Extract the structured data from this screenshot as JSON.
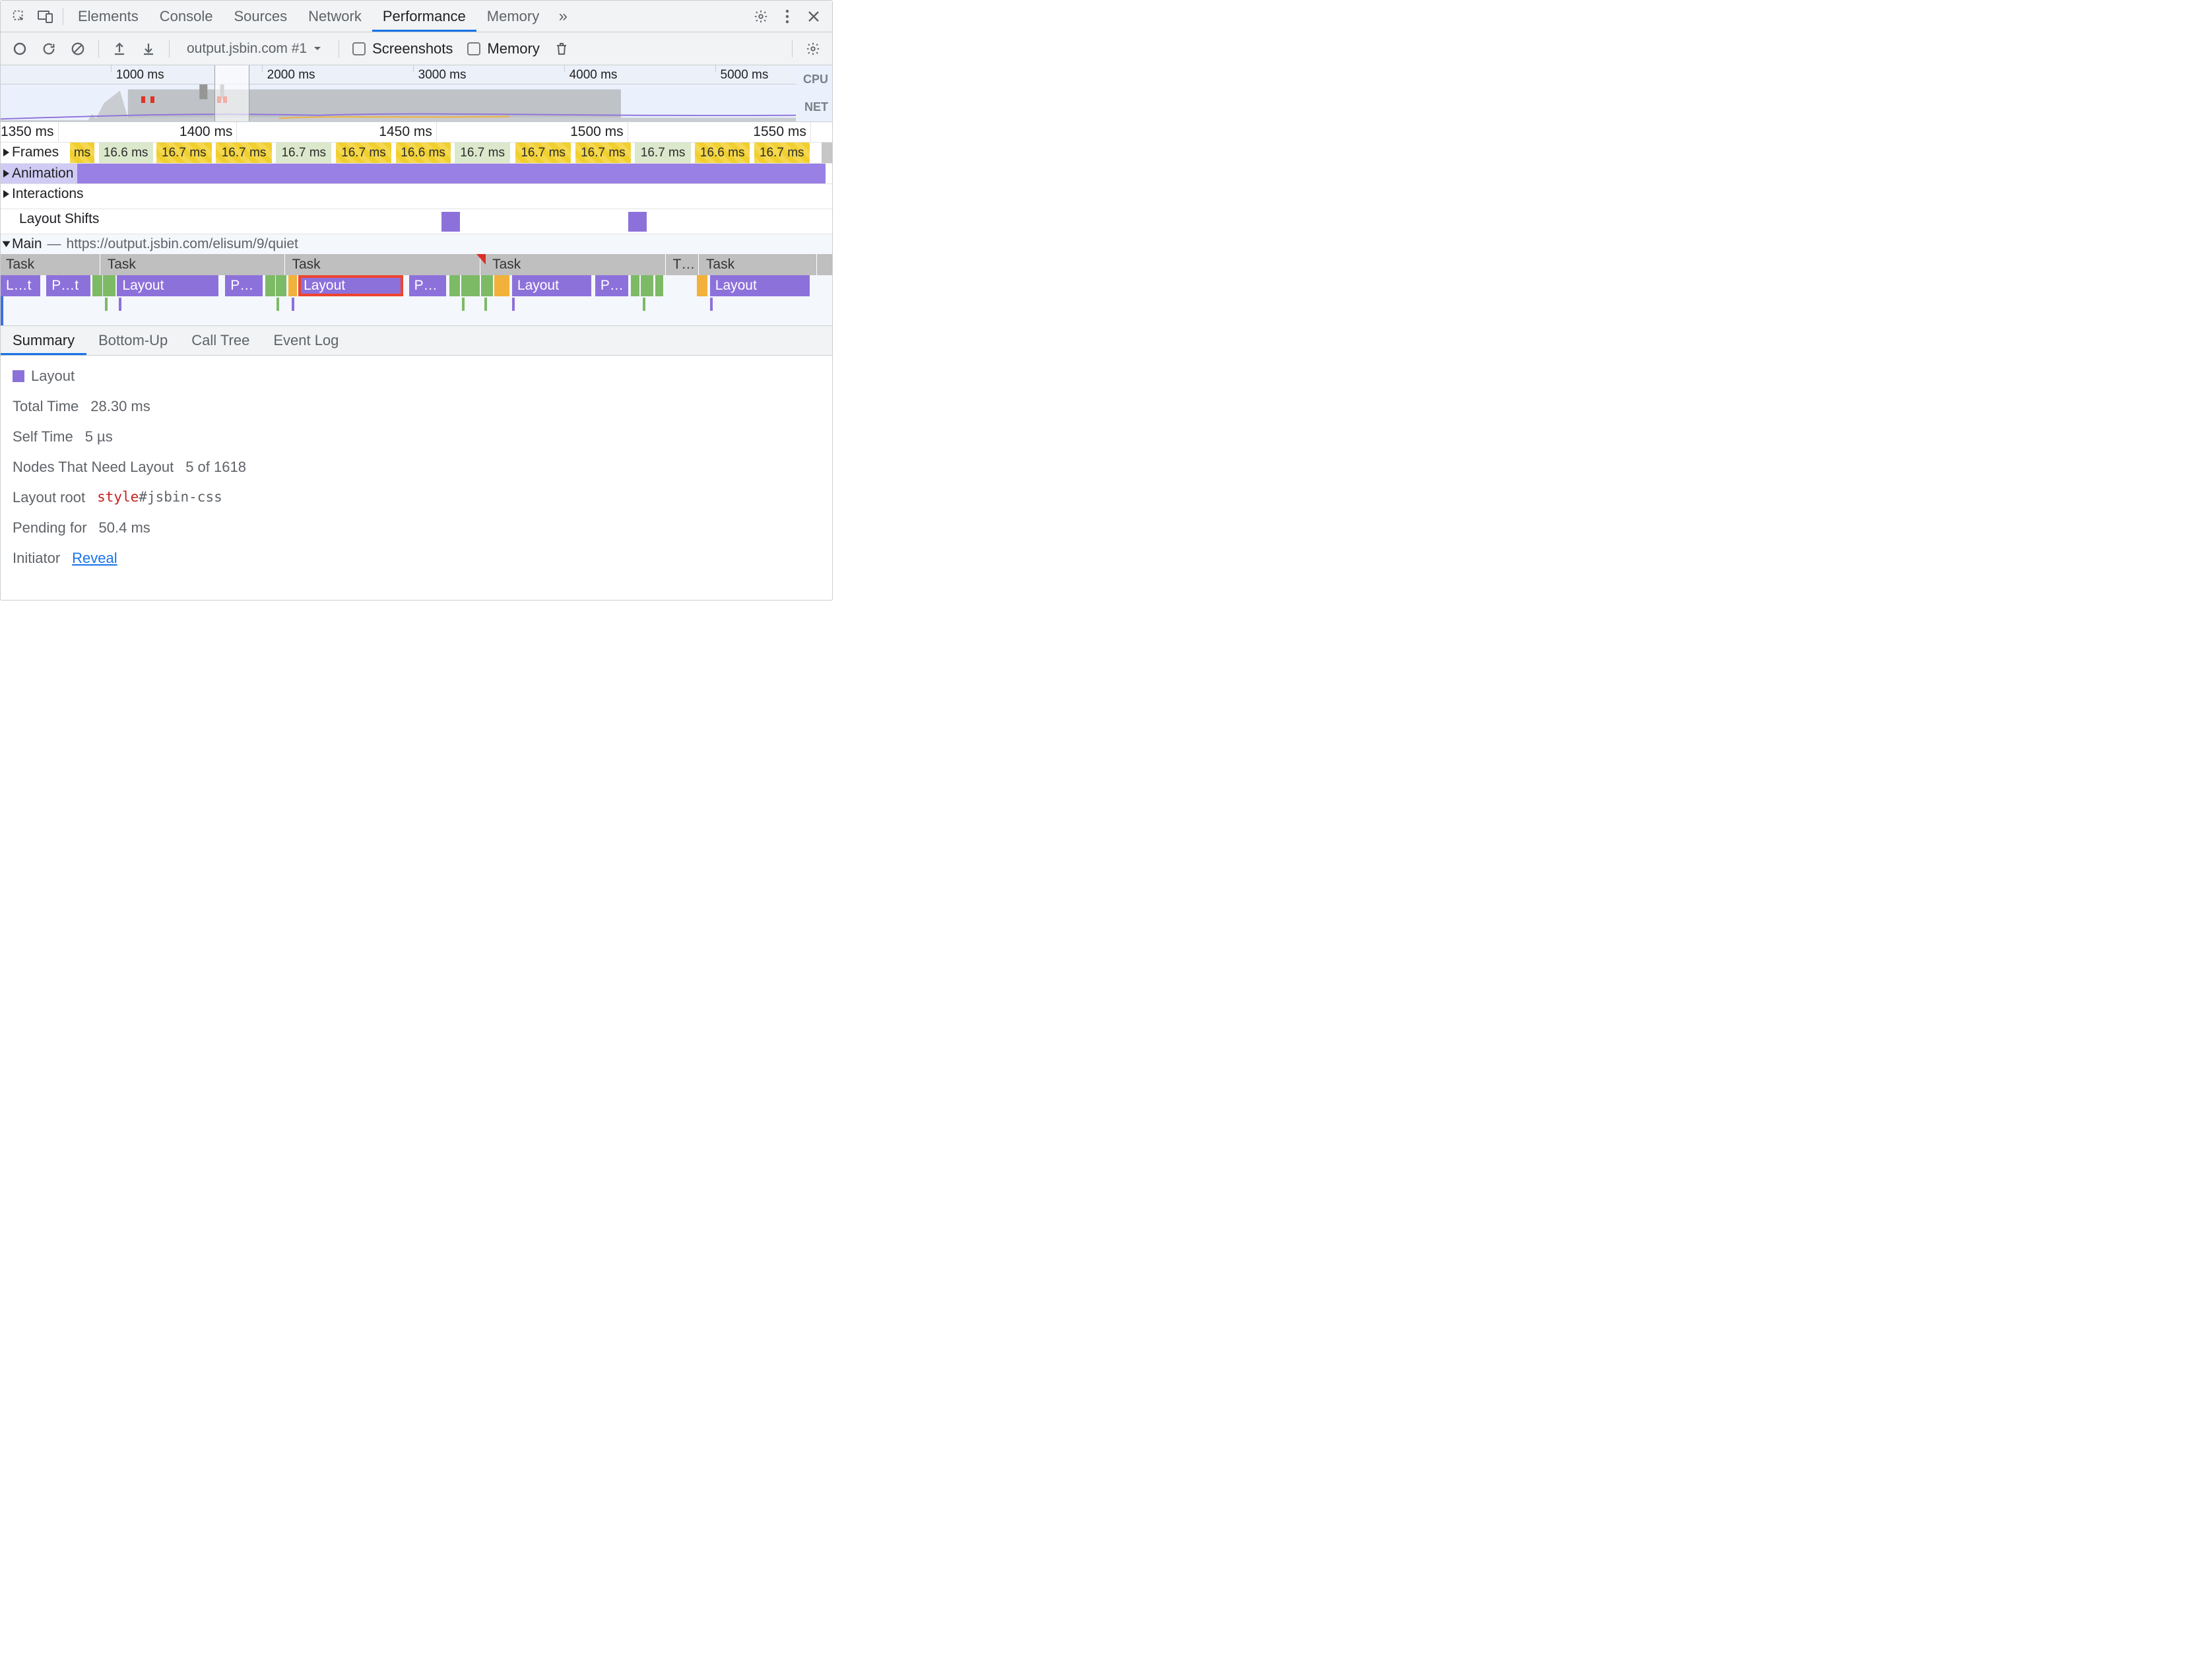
{
  "topTabs": {
    "items": [
      {
        "label": "Elements",
        "active": false
      },
      {
        "label": "Console",
        "active": false
      },
      {
        "label": "Sources",
        "active": false
      },
      {
        "label": "Network",
        "active": false
      },
      {
        "label": "Performance",
        "active": true
      },
      {
        "label": "Memory",
        "active": false
      }
    ],
    "overflowGlyph": "»"
  },
  "perfToolbar": {
    "target": "output.jsbin.com #1",
    "screenshotsLabel": "Screenshots",
    "screenshotsChecked": false,
    "memoryLabel": "Memory",
    "memoryChecked": false
  },
  "overview": {
    "ticks": [
      {
        "label": "1000 ms",
        "pct": 14.5
      },
      {
        "label": "2000 ms",
        "pct": 33.5
      },
      {
        "label": "3000 ms",
        "pct": 52.5
      },
      {
        "label": "4000 ms",
        "pct": 71.5
      },
      {
        "label": "5000 ms",
        "pct": 90.5
      }
    ],
    "selection": {
      "leftPct": 25.7,
      "widthPct": 4.2
    },
    "sideLabels": {
      "cpu": "CPU",
      "net": "NET"
    }
  },
  "ruler": {
    "ticks": [
      {
        "label": "1350 ms",
        "leftPct": 0
      },
      {
        "label": "1400 ms",
        "leftPct": 21.5
      },
      {
        "label": "1450 ms",
        "leftPct": 45.5
      },
      {
        "label": "1500 ms",
        "leftPct": 68.5
      },
      {
        "label": "1550 ms",
        "leftPct": 90.5
      }
    ]
  },
  "frames": {
    "header": "Frames",
    "cells": [
      {
        "label": "ms",
        "kind": "yellow",
        "leftPct": 8.3,
        "widthPct": 3.0
      },
      {
        "label": "16.6 ms",
        "kind": "green",
        "leftPct": 11.8,
        "widthPct": 6.5
      },
      {
        "label": "16.7 ms",
        "kind": "yellow",
        "leftPct": 18.7,
        "widthPct": 6.7
      },
      {
        "label": "16.7 ms",
        "kind": "yellow",
        "leftPct": 25.9,
        "widthPct": 6.7
      },
      {
        "label": "16.7 ms",
        "kind": "green",
        "leftPct": 33.1,
        "widthPct": 6.7
      },
      {
        "label": "16.7 ms",
        "kind": "yellow",
        "leftPct": 40.3,
        "widthPct": 6.7
      },
      {
        "label": "16.6 ms",
        "kind": "yellow",
        "leftPct": 47.5,
        "widthPct": 6.6
      },
      {
        "label": "16.7 ms",
        "kind": "green",
        "leftPct": 54.6,
        "widthPct": 6.7
      },
      {
        "label": "16.7 ms",
        "kind": "yellow",
        "leftPct": 61.9,
        "widthPct": 6.7
      },
      {
        "label": "16.7 ms",
        "kind": "yellow",
        "leftPct": 69.1,
        "widthPct": 6.7
      },
      {
        "label": "16.7 ms",
        "kind": "green",
        "leftPct": 76.3,
        "widthPct": 6.7
      },
      {
        "label": "16.6 ms",
        "kind": "yellow",
        "leftPct": 83.5,
        "widthPct": 6.6
      },
      {
        "label": "16.7 ms",
        "kind": "yellow",
        "leftPct": 90.6,
        "widthPct": 6.7
      }
    ]
  },
  "animationLane": {
    "header": "Animation"
  },
  "interactionsLane": {
    "header": "Interactions"
  },
  "layoutShifts": {
    "header": "Layout Shifts",
    "blocks": [
      {
        "leftPct": 53.0
      },
      {
        "leftPct": 75.5
      }
    ]
  },
  "main": {
    "header": "Main",
    "urlSeparator": "—",
    "url": "https://output.jsbin.com/elisum/9/quiet",
    "tasks": [
      {
        "label": "Task",
        "leftPct": 0,
        "widthPct": 12
      },
      {
        "label": "Task",
        "leftPct": 12.2,
        "widthPct": 22
      },
      {
        "label": "Task",
        "leftPct": 34.4,
        "widthPct": 23.3
      },
      {
        "label": "Task",
        "leftPct": 58.5,
        "widthPct": 21.5
      },
      {
        "label": "T…",
        "leftPct": 80.2,
        "widthPct": 3.8
      },
      {
        "label": "Task",
        "leftPct": 84.2,
        "widthPct": 14
      }
    ],
    "taskRedWedgeLeftPct": 57.2,
    "flames": [
      {
        "label": "L…t",
        "kind": "purple",
        "leftPct": 0,
        "widthPct": 4.8
      },
      {
        "label": "P…t",
        "kind": "purple",
        "leftPct": 5.5,
        "widthPct": 5.3
      },
      {
        "label": "",
        "kind": "green",
        "leftPct": 11.0,
        "widthPct": 1.2
      },
      {
        "label": "",
        "kind": "green",
        "leftPct": 12.3,
        "widthPct": 1.5
      },
      {
        "label": "Layout",
        "kind": "purple",
        "leftPct": 14.0,
        "widthPct": 12.2
      },
      {
        "label": "P…",
        "kind": "purple",
        "leftPct": 27.0,
        "widthPct": 4.5
      },
      {
        "label": "",
        "kind": "green",
        "leftPct": 31.8,
        "widthPct": 1.2
      },
      {
        "label": "",
        "kind": "green",
        "leftPct": 33.1,
        "widthPct": 1.3
      },
      {
        "label": "",
        "kind": "orange",
        "leftPct": 34.6,
        "widthPct": 1.0
      },
      {
        "label": "Layout",
        "kind": "purple",
        "leftPct": 35.8,
        "widthPct": 12.6,
        "highlight": true
      },
      {
        "label": "P…",
        "kind": "purple",
        "leftPct": 49.1,
        "widthPct": 4.5
      },
      {
        "label": "",
        "kind": "green",
        "leftPct": 54.0,
        "widthPct": 1.2
      },
      {
        "label": "",
        "kind": "green",
        "leftPct": 55.4,
        "widthPct": 2.2
      },
      {
        "label": "",
        "kind": "green",
        "leftPct": 57.8,
        "widthPct": 1.4
      },
      {
        "label": "",
        "kind": "orange",
        "leftPct": 59.4,
        "widthPct": 1.8
      },
      {
        "label": "Layout",
        "kind": "purple",
        "leftPct": 61.5,
        "widthPct": 9.5
      },
      {
        "label": "P…",
        "kind": "purple",
        "leftPct": 71.5,
        "widthPct": 4.0
      },
      {
        "label": "",
        "kind": "green",
        "leftPct": 75.8,
        "widthPct": 1.0
      },
      {
        "label": "",
        "kind": "green",
        "leftPct": 77.0,
        "widthPct": 1.5
      },
      {
        "label": "",
        "kind": "green",
        "leftPct": 78.7,
        "widthPct": 1.0
      },
      {
        "label": "",
        "kind": "orange",
        "leftPct": 83.7,
        "widthPct": 0.6
      },
      {
        "label": "",
        "kind": "orange",
        "leftPct": 84.4,
        "widthPct": 0.6
      },
      {
        "label": "Layout",
        "kind": "purple",
        "leftPct": 85.3,
        "widthPct": 12.0
      }
    ],
    "thins": [
      {
        "leftPct": 12.5,
        "color": "#7dba66"
      },
      {
        "leftPct": 14.2,
        "color": "#8d71db"
      },
      {
        "leftPct": 33.2,
        "color": "#7dba66"
      },
      {
        "leftPct": 35.0,
        "color": "#8d71db"
      },
      {
        "leftPct": 55.5,
        "color": "#7dba66"
      },
      {
        "leftPct": 58.2,
        "color": "#7dba66"
      },
      {
        "leftPct": 61.5,
        "color": "#8d71db"
      },
      {
        "leftPct": 77.2,
        "color": "#7dba66"
      },
      {
        "leftPct": 85.3,
        "color": "#8d71db"
      }
    ]
  },
  "detailTabs": {
    "items": [
      {
        "label": "Summary",
        "active": true
      },
      {
        "label": "Bottom-Up",
        "active": false
      },
      {
        "label": "Call Tree",
        "active": false
      },
      {
        "label": "Event Log",
        "active": false
      }
    ]
  },
  "summary": {
    "eventName": "Layout",
    "rows": {
      "totalTime": {
        "label": "Total Time",
        "value": "28.30 ms"
      },
      "selfTime": {
        "label": "Self Time",
        "value": "5 µs"
      },
      "nodes": {
        "label": "Nodes That Need Layout",
        "value": "5 of 1618"
      },
      "layoutRoot": {
        "label": "Layout root",
        "tag": "style",
        "selector": "#jsbin-css"
      },
      "pendingFor": {
        "label": "Pending for",
        "value": "50.4 ms"
      },
      "initiator": {
        "label": "Initiator",
        "link": "Reveal"
      }
    }
  }
}
